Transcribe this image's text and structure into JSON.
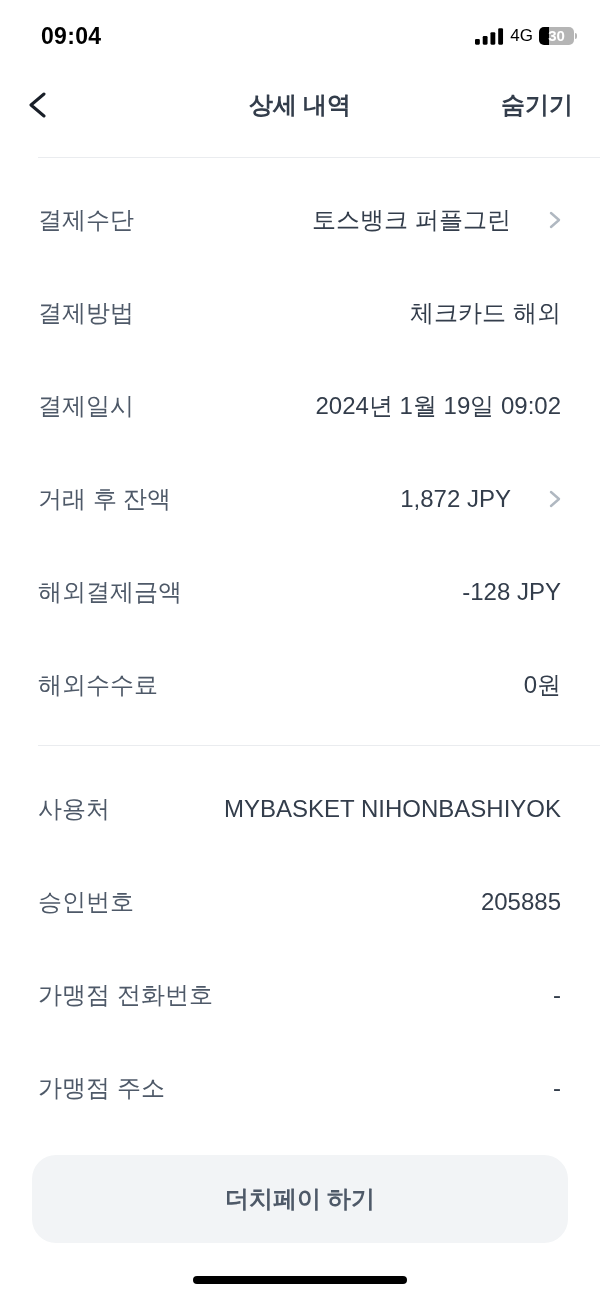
{
  "status_bar": {
    "time": "09:04",
    "network": "4G",
    "battery": "30"
  },
  "nav": {
    "title": "상세 내역",
    "action": "숨기기"
  },
  "sections": [
    {
      "rows": [
        {
          "label": "결제수단",
          "value": "토스뱅크 퍼플그린",
          "kind": "link"
        },
        {
          "label": "결제방법",
          "value": "체크카드 해외",
          "kind": "plain"
        },
        {
          "label": "결제일시",
          "value": "2024년 1월 19일 09:02",
          "kind": "plain"
        },
        {
          "label": "거래 후 잔액",
          "value": "1,872 JPY",
          "kind": "link"
        },
        {
          "label": "해외결제금액",
          "value": "-128 JPY",
          "kind": "plain"
        },
        {
          "label": "해외수수료",
          "value": "0원",
          "kind": "plain"
        }
      ]
    },
    {
      "rows": [
        {
          "label": "사용처",
          "value": "MYBASKET NIHONBASHIYOK",
          "kind": "plain"
        },
        {
          "label": "승인번호",
          "value": "205885",
          "kind": "plain"
        },
        {
          "label": "가맹점 전화번호",
          "value": "-",
          "kind": "plain"
        },
        {
          "label": "가맹점 주소",
          "value": "-",
          "kind": "plain"
        }
      ]
    }
  ],
  "button": {
    "label": "더치페이 하기"
  }
}
